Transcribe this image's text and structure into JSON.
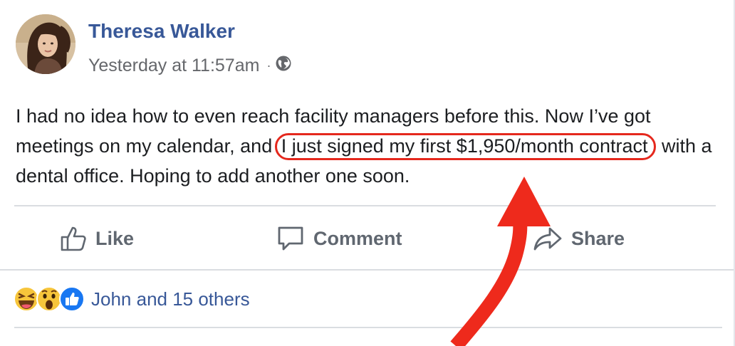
{
  "post": {
    "author": "Theresa Walker",
    "timestamp": "Yesterday at 11:57am",
    "separator": "·",
    "privacy_icon": "globe-icon",
    "text_before": "I had no idea how to even reach facility managers before this. Now I’ve got meetings on my calendar, and",
    "text_highlight": "I just signed my first $1,950/month contract",
    "text_after": "with a dental office. Hoping to add another one soon."
  },
  "actions": {
    "like_label": "Like",
    "comment_label": "Comment",
    "share_label": "Share"
  },
  "reactions": {
    "icons": [
      "laughing-emoji-icon",
      "wow-emoji-icon",
      "like-reaction-icon"
    ],
    "summary": "John and 15 others"
  },
  "colors": {
    "author_link": "#385898",
    "highlight": "#e5281d",
    "action_text": "#606770",
    "like_blue": "#1877f2"
  }
}
